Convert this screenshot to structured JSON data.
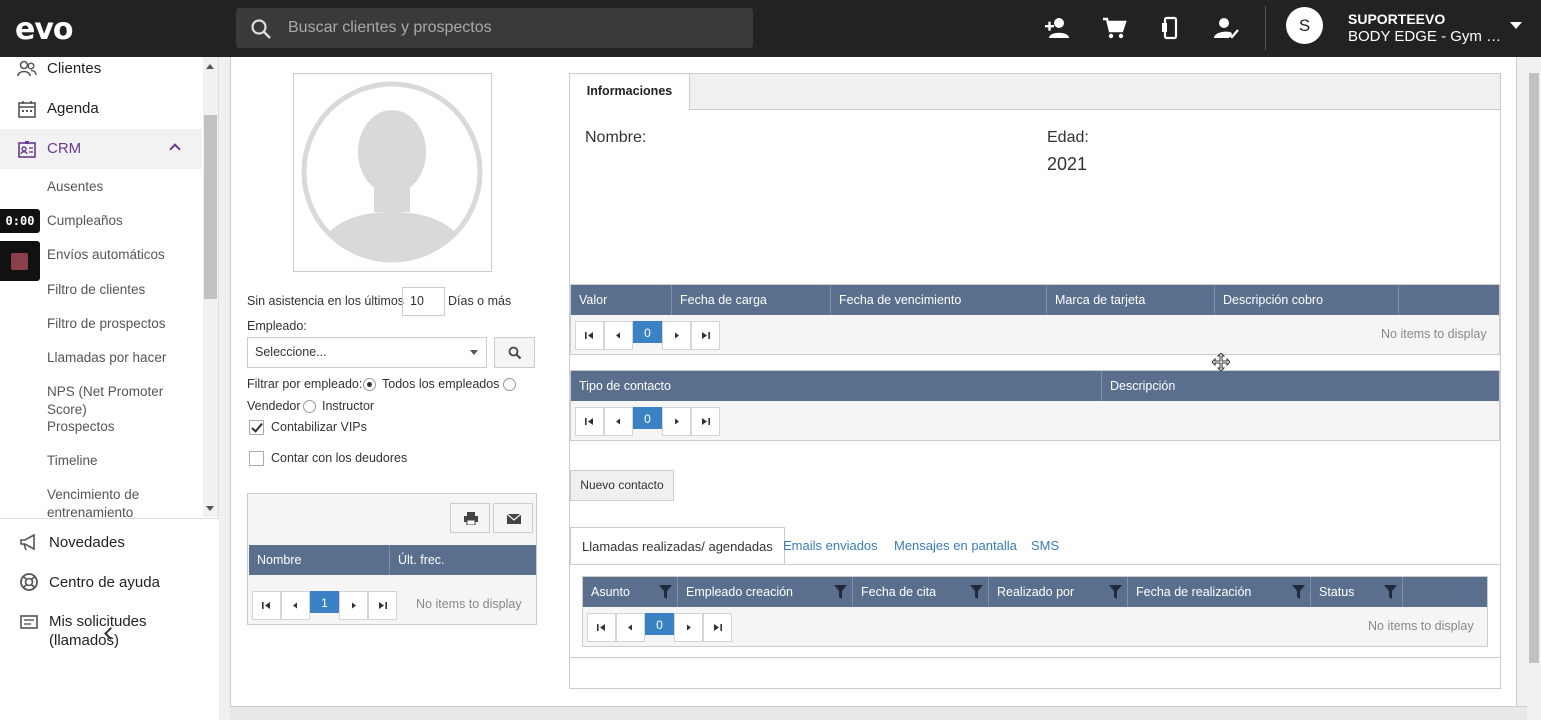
{
  "app": {
    "logo": "evo"
  },
  "search": {
    "placeholder": "Buscar clientes y prospectos"
  },
  "topbar_icons": [
    "add-person-icon",
    "cart-icon",
    "device-icon",
    "person-check-icon"
  ],
  "user": {
    "initial": "S",
    "name": "SUPORTEEVO",
    "company": "BODY EDGE - Gym Fitness"
  },
  "sidebar": {
    "items": [
      {
        "label": "Clientes",
        "icon": "clients-icon"
      },
      {
        "label": "Agenda",
        "icon": "calendar-icon"
      },
      {
        "label": "CRM",
        "icon": "crm-icon"
      }
    ],
    "crm_sub": [
      "Ausentes",
      "Cumpleaños",
      "Envíos automáticos",
      "Filtro de clientes",
      "Filtro de prospectos",
      "Llamadas por hacer",
      "NPS (Net Promoter Score)",
      "Prospectos",
      "Timeline",
      "Vencimiento de entrenamiento"
    ],
    "bottom": [
      {
        "label": "Novedades",
        "icon": "megaphone-icon"
      },
      {
        "label": "Centro de ayuda",
        "icon": "lifebuoy-icon"
      },
      {
        "label": "Mis solicitudes (llamados)",
        "icon": "ticket-icon"
      }
    ]
  },
  "timer": {
    "value": "0:00"
  },
  "filters": {
    "absence_prefix": "Sin asistencia en los últimos",
    "absence_days": "10",
    "absence_suffix": "Días o más",
    "employee_label": "Empleado:",
    "employee_placeholder": "Seleccione...",
    "filter_by_label": "Filtrar por empleado:",
    "radio_all": "Todos los empleados",
    "radio_seller": "Vendedor",
    "radio_instructor": "Instructor",
    "vip_label": "Contabilizar VIPs",
    "vip_checked": true,
    "debtors_label": "Contar con los deudores",
    "debtors_checked": false
  },
  "left_grid": {
    "columns": [
      "Nombre",
      "Últ. frec."
    ],
    "page": "1",
    "empty": "No items to display"
  },
  "info": {
    "tab": "Informaciones",
    "name_label": "Nombre:",
    "age_label": "Edad:",
    "age_value": "2021"
  },
  "cards_grid": {
    "columns": [
      "Valor",
      "Fecha de carga",
      "Fecha de vencimiento",
      "Marca de tarjeta",
      "Descripción cobro"
    ],
    "page": "0",
    "empty": "No items to display"
  },
  "contacts_grid": {
    "columns": [
      "Tipo de contacto",
      "Descripción"
    ],
    "page": "0"
  },
  "new_contact_button": "Nuevo contacto",
  "subtabs": [
    "Llamadas realizadas/ agendadas",
    "Emails enviados",
    "Mensajes en pantalla",
    "SMS"
  ],
  "calls_grid": {
    "columns": [
      "Asunto",
      "Empleado creación",
      "Fecha de cita",
      "Realizado por",
      "Fecha de realización",
      "Status"
    ],
    "page": "0",
    "empty": "No items to display"
  },
  "colors": {
    "topbar": "#222222",
    "accent": "#6b3a8e",
    "grid_header": "#5a6f8e",
    "pager_current": "#3b82c4"
  }
}
